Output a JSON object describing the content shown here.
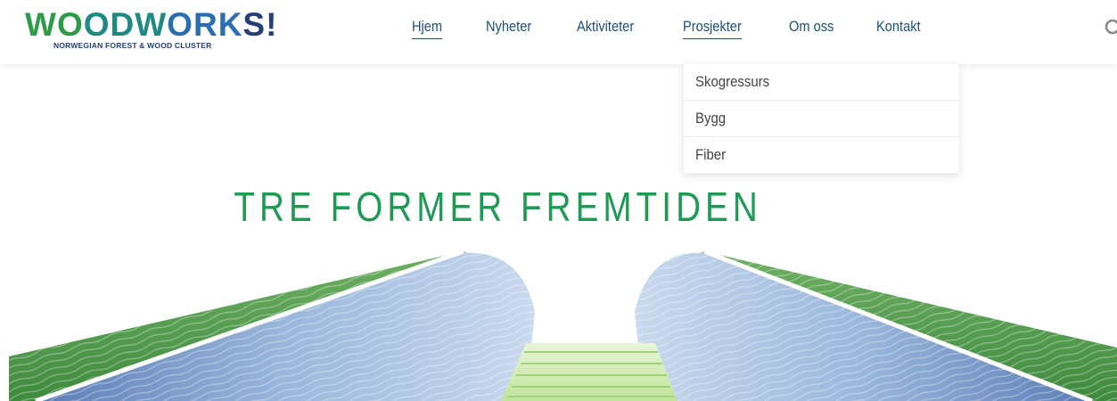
{
  "logo": {
    "letters": [
      {
        "char": "W",
        "color": "#2d9b47"
      },
      {
        "char": "O",
        "color": "#2d9b47"
      },
      {
        "char": "O",
        "color": "#1e8a82"
      },
      {
        "char": "D",
        "color": "#1e8a82"
      },
      {
        "char": "W",
        "color": "#1e8a82"
      },
      {
        "char": "O",
        "color": "#2b6fb0"
      },
      {
        "char": "R",
        "color": "#2b6fb0"
      },
      {
        "char": "K",
        "color": "#2b6fb0"
      },
      {
        "char": "S",
        "color": "#253f7a"
      },
      {
        "char": "!",
        "color": "#253f7a"
      }
    ],
    "subtitle": "NORWEGIAN FOREST & WOOD CLUSTER"
  },
  "nav": {
    "items": [
      {
        "label": "Hjem",
        "active": true
      },
      {
        "label": "Nyheter"
      },
      {
        "label": "Aktiviteter"
      },
      {
        "label": "Prosjekter",
        "open": true
      },
      {
        "label": "Om oss"
      },
      {
        "label": "Kontakt"
      }
    ],
    "search_icon": "search-icon"
  },
  "dropdown": {
    "items": [
      "Skogressurs",
      "Bygg",
      "Fiber"
    ]
  },
  "hero": {
    "title": "TRE FORMER FREMTIDEN"
  },
  "colors": {
    "nav_text": "#1f4f7a",
    "title_green": "#1e9a55",
    "wood_green": "#4e9a4a",
    "wood_blue": "#7ea0cf"
  }
}
